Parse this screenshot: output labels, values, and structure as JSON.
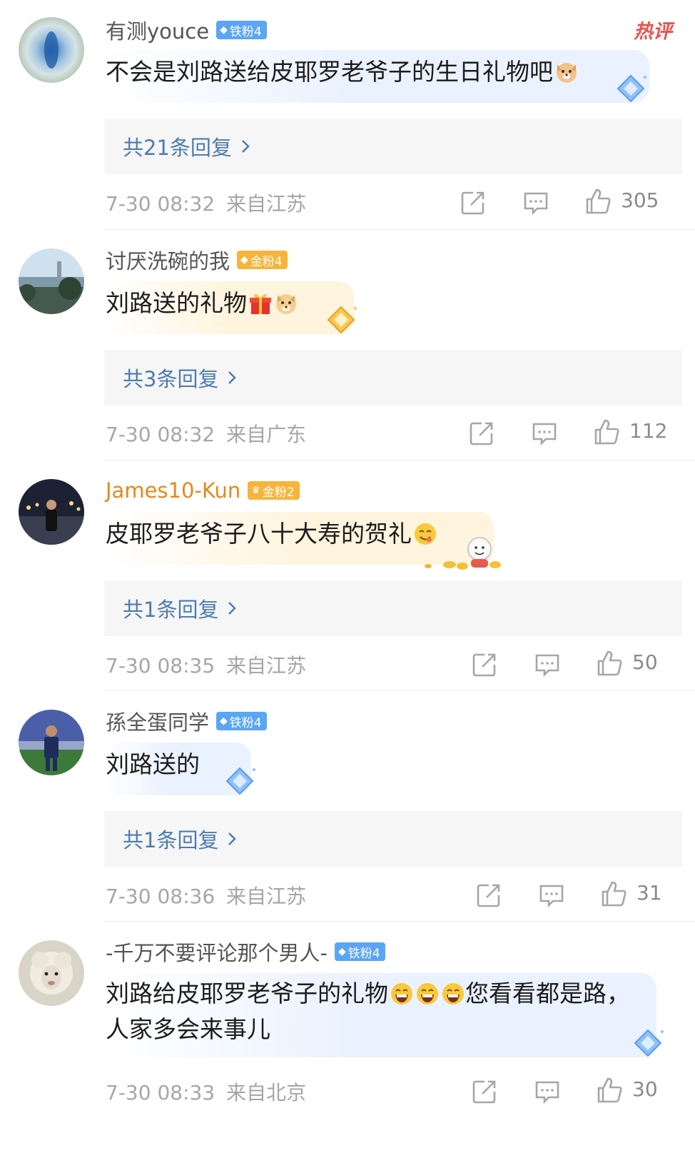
{
  "comments": [
    {
      "username": "有测youce",
      "badge": "铁粉4",
      "hot_tag": "热评",
      "text": "不会是刘路送给皮耶罗老爷子的生日礼物吧",
      "replies": "共21条回复",
      "time": "7-30 08:32",
      "location": "来自江苏",
      "likes": "305"
    },
    {
      "username": "讨厌洗碗的我",
      "badge": "金粉4",
      "text": "刘路送的礼物",
      "replies": "共3条回复",
      "time": "7-30 08:32",
      "location": "来自广东",
      "likes": "112"
    },
    {
      "username": "James10-Kun",
      "badge": "金粉2",
      "text": "皮耶罗老爷子八十大寿的贺礼",
      "replies": "共1条回复",
      "time": "7-30 08:35",
      "location": "来自江苏",
      "likes": "50"
    },
    {
      "username": "孫全蛋同学",
      "badge": "铁粉4",
      "text": "刘路送的",
      "replies": "共1条回复",
      "time": "7-30 08:36",
      "location": "来自江苏",
      "likes": "31"
    },
    {
      "username": "-千万不要评论那个男人-",
      "badge": "铁粉4",
      "text_line1a": "刘路给皮耶罗老爷子的礼物",
      "text_line1b": "您看看都是路，",
      "text_line2": "人家多会来事儿",
      "time": "7-30 08:33",
      "location": "来自北京",
      "likes": "30"
    }
  ],
  "icons": {
    "share": "share-icon",
    "comment": "comment-icon",
    "like": "like-icon",
    "chevron": "chevron-right-icon"
  },
  "colors": {
    "reply_link": "#4d7bb0",
    "hot": "#e8524d",
    "iron_badge": "#5aa5f4",
    "gold_badge": "#f6b53a"
  }
}
